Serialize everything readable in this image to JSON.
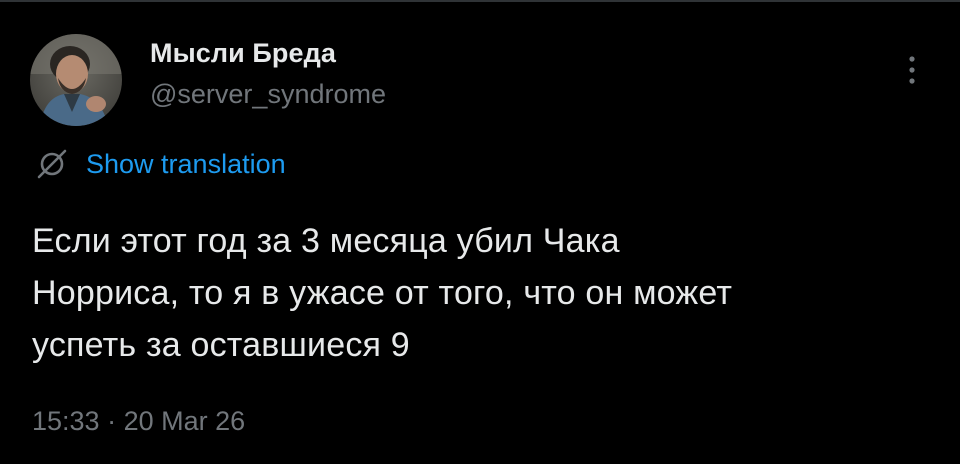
{
  "user": {
    "display_name": "Мысли Бреда",
    "handle": "@server_syndrome"
  },
  "icons": {
    "more": "more-vertical-icon",
    "translate": "translate-icon",
    "avatar": "avatar-photo"
  },
  "translation": {
    "label": "Show translation"
  },
  "tweet": {
    "lines": [
      "Если этот год за 3 месяца убил Чака",
      "Норриса, то я в ужасе от того, что он может",
      "успеть за оставшиеся 9"
    ]
  },
  "meta": {
    "time": "15:33",
    "separator": " · ",
    "date": "20 Mar 26"
  },
  "colors": {
    "background": "#000000",
    "text": "#e7e9ea",
    "secondary": "#71767b",
    "link": "#1d9bf0"
  }
}
